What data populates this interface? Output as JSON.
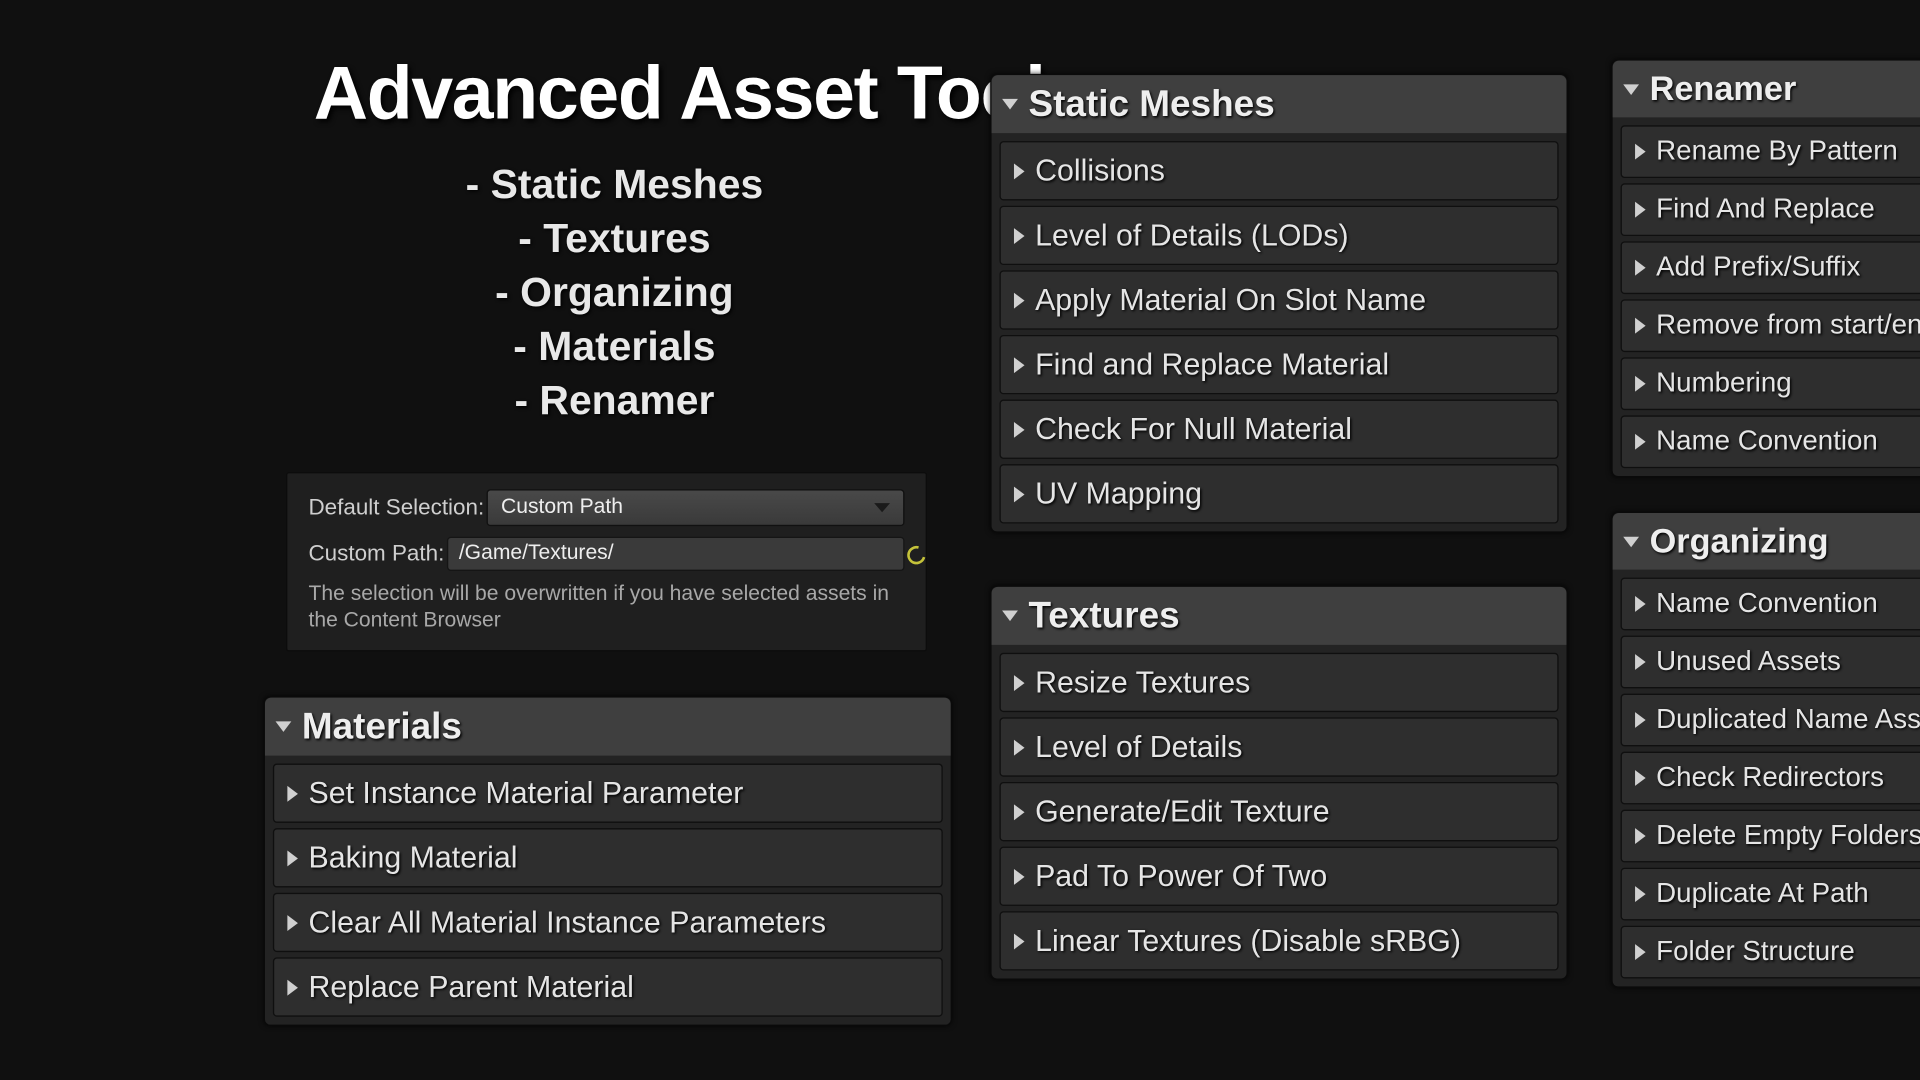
{
  "title": "Advanced Asset Tool",
  "features": {
    "0": "Static Meshes",
    "1": "Textures",
    "2": "Organizing",
    "3": "Materials",
    "4": "Renamer"
  },
  "config": {
    "default_selection_label": "Default Selection:",
    "default_selection_value": "Custom Path",
    "custom_path_label": "Custom Path:",
    "custom_path_value": "/Game/Textures/",
    "help_text": "The selection will be overwritten if you have selected assets in the Content Browser"
  },
  "panels": {
    "materials": {
      "title": "Materials",
      "items": {
        "0": "Set Instance Material Parameter",
        "1": "Baking Material",
        "2": "Clear All Material Instance Parameters",
        "3": "Replace Parent Material"
      }
    },
    "static_meshes": {
      "title": "Static Meshes",
      "items": {
        "0": "Collisions",
        "1": "Level of Details (LODs)",
        "2": "Apply Material On Slot Name",
        "3": "Find and Replace Material",
        "4": "Check For Null Material",
        "5": "UV Mapping"
      }
    },
    "textures": {
      "title": "Textures",
      "items": {
        "0": "Resize Textures",
        "1": "Level of Details",
        "2": "Generate/Edit Texture",
        "3": "Pad To Power Of Two",
        "4": "Linear Textures (Disable sRBG)"
      }
    },
    "renamer": {
      "title": "Renamer",
      "items": {
        "0": "Rename By Pattern",
        "1": "Find And Replace",
        "2": "Add Prefix/Suffix",
        "3": "Remove from start/end",
        "4": "Numbering",
        "5": "Name Convention"
      }
    },
    "organizing": {
      "title": "Organizing",
      "items": {
        "0": "Name Convention",
        "1": "Unused Assets",
        "2": "Duplicated Name Assets",
        "3": "Check Redirectors",
        "4": "Delete Empty Folders",
        "5": "Duplicate At Path",
        "6": "Folder Structure"
      }
    }
  }
}
